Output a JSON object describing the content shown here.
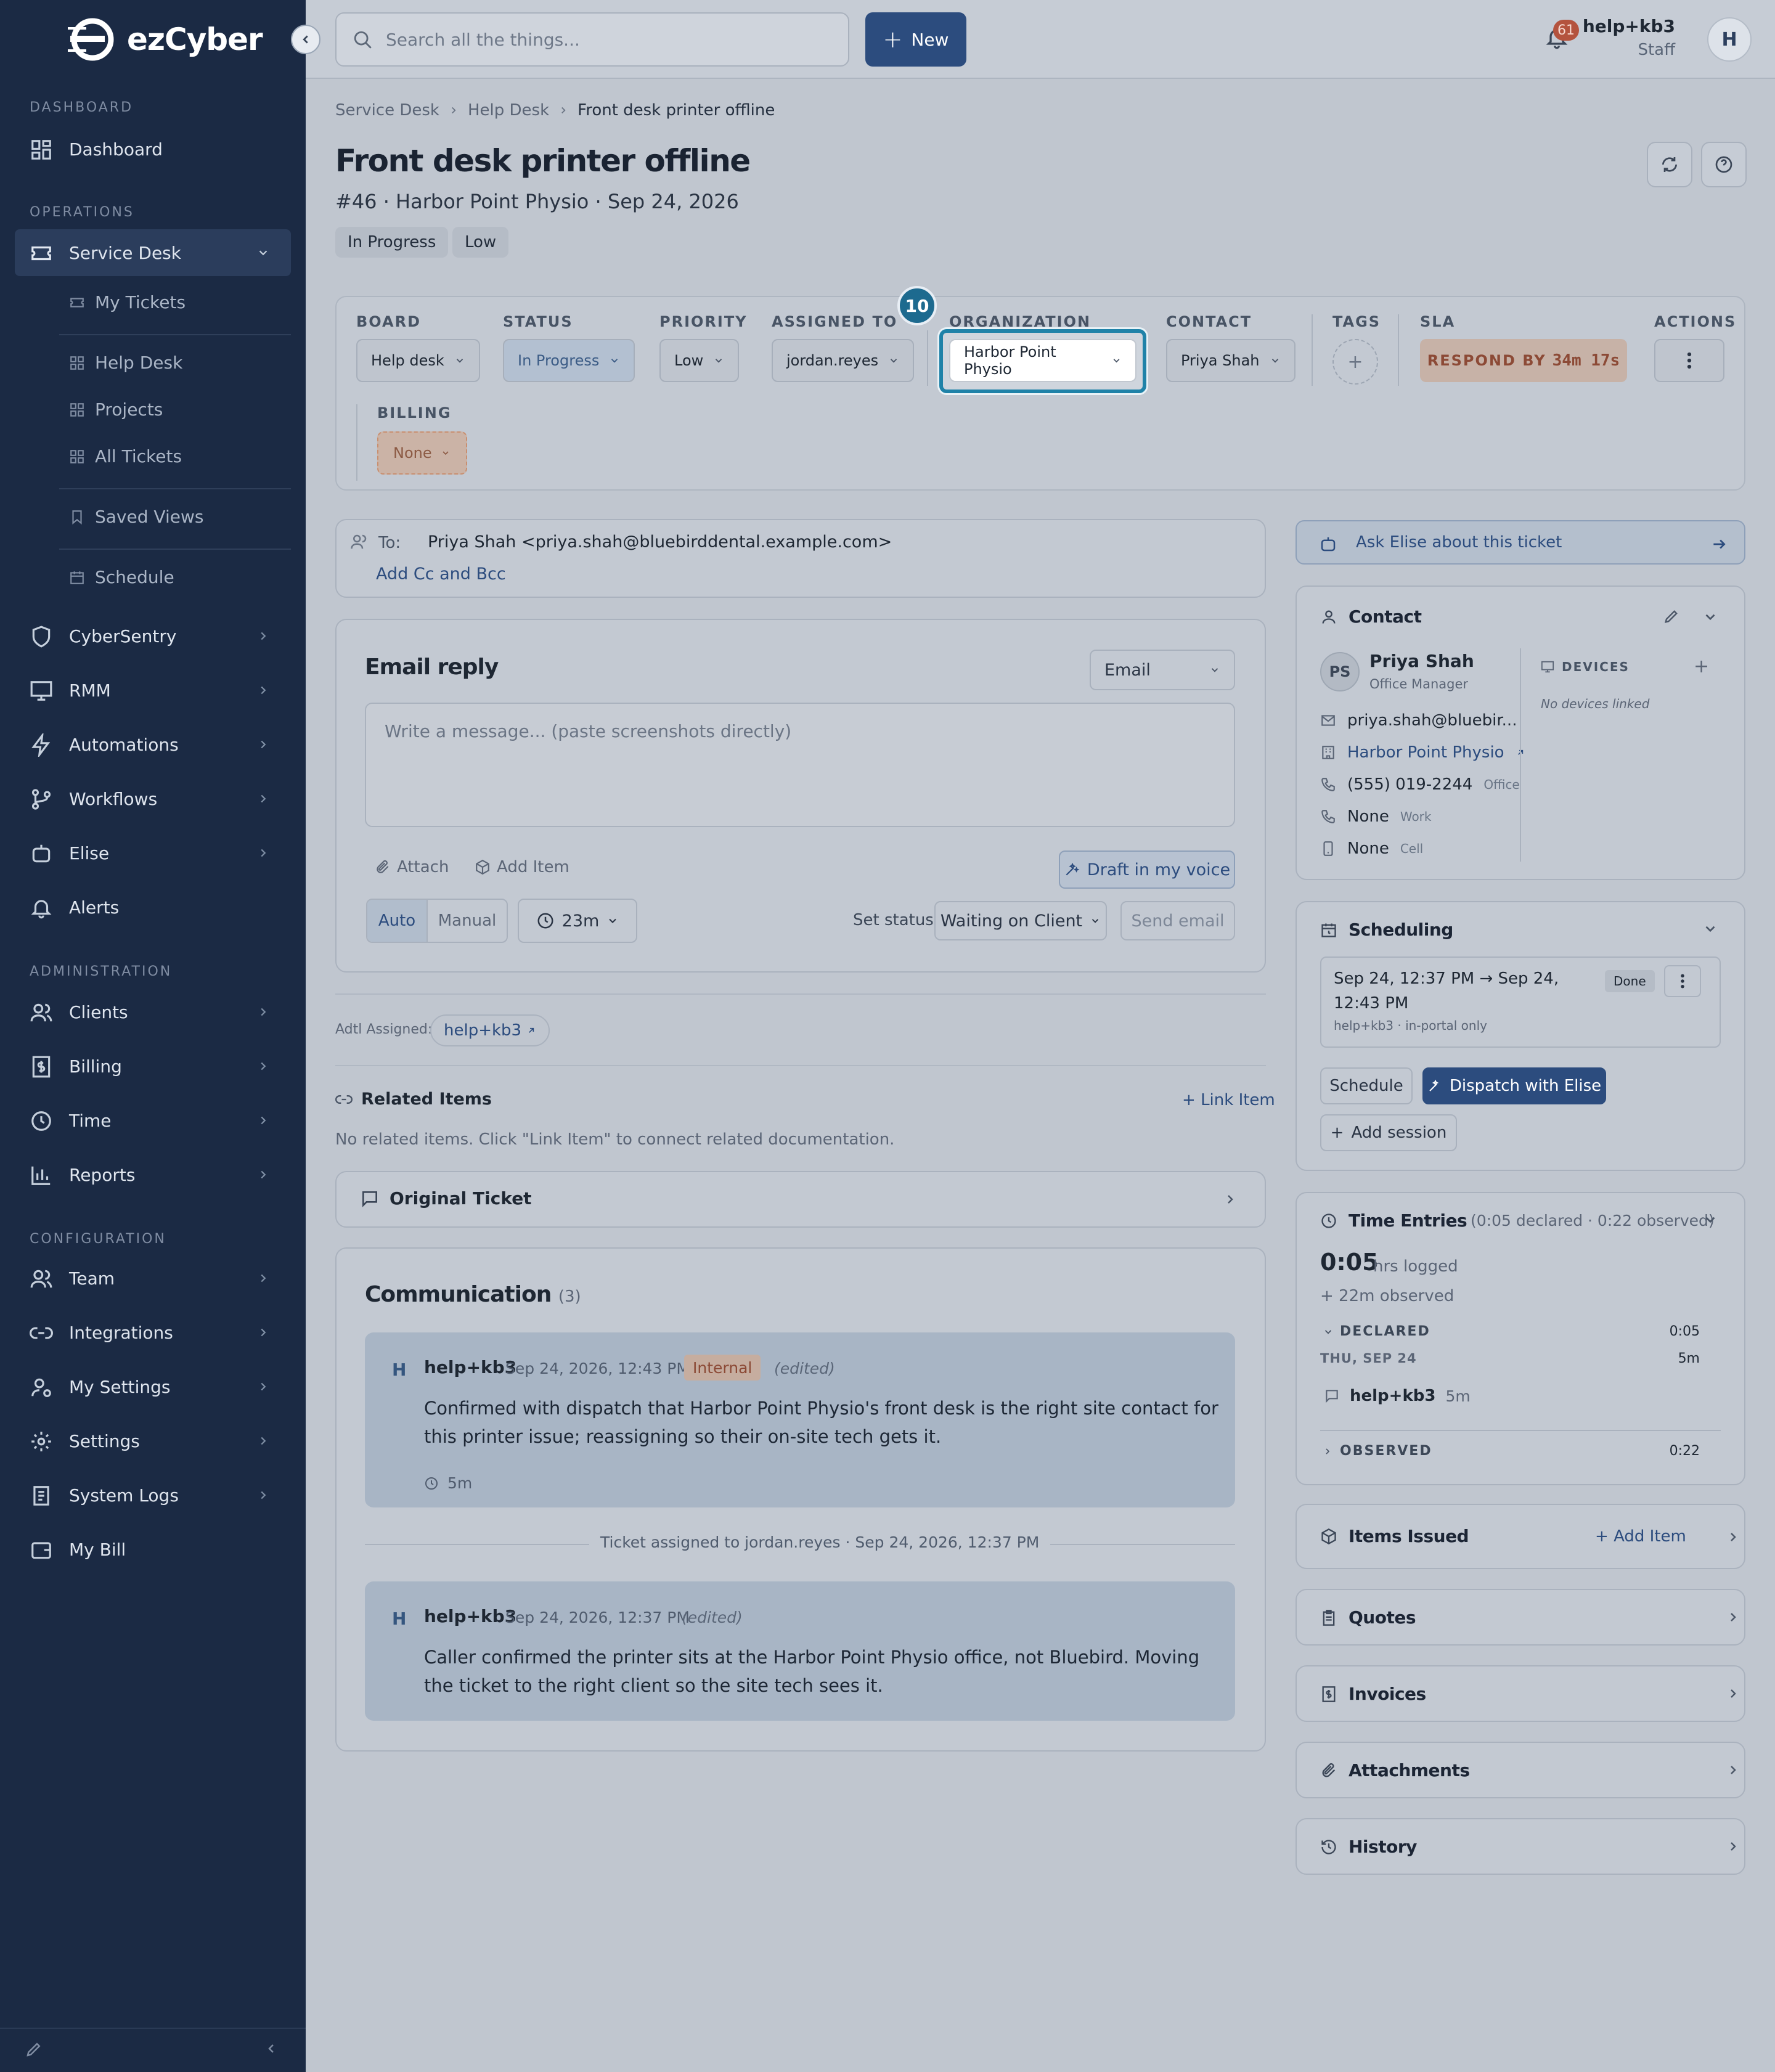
{
  "app": {
    "logo_text": "ezCyber"
  },
  "sidebar": {
    "sections": {
      "dashboard": "DASHBOARD",
      "operations": "OPERATIONS",
      "administration": "ADMINISTRATION",
      "configuration": "CONFIGURATION"
    },
    "dashboard": "Dashboard",
    "service_desk": "Service Desk",
    "sub": {
      "my_tickets": "My Tickets",
      "help_desk": "Help Desk",
      "projects": "Projects",
      "all_tickets": "All Tickets",
      "saved_views": "Saved Views",
      "schedule": "Schedule"
    },
    "ops": [
      "CyberSentry",
      "RMM",
      "Automations",
      "Workflows",
      "Elise",
      "Alerts"
    ],
    "admin": [
      "Clients",
      "Billing",
      "Time",
      "Reports"
    ],
    "config": [
      "Team",
      "Integrations",
      "My Settings",
      "Settings",
      "System Logs",
      "My Bill"
    ]
  },
  "topbar": {
    "search_placeholder": "Search all the things...",
    "new_label": "New",
    "notif_count": "61",
    "user_name": "help+kb3",
    "user_role": "Staff",
    "avatar": "H"
  },
  "breadcrumb": [
    "Service Desk",
    "Help Desk",
    "Front desk printer offline"
  ],
  "ticket": {
    "title": "Front desk printer offline",
    "subtitle": "#46 · Harbor Point Physio · Sep 24, 2026",
    "chips": [
      "In Progress",
      "Low"
    ]
  },
  "fields": {
    "board": {
      "label": "BOARD",
      "value": "Help desk"
    },
    "status": {
      "label": "STATUS",
      "value": "In Progress"
    },
    "priority": {
      "label": "PRIORITY",
      "value": "Low"
    },
    "assigned": {
      "label": "ASSIGNED TO",
      "value": "jordan.reyes"
    },
    "organization": {
      "label": "ORGANIZATION",
      "value": "Harbor Point Physio"
    },
    "contact": {
      "label": "CONTACT",
      "value": "Priya Shah"
    },
    "tags": {
      "label": "TAGS"
    },
    "sla": {
      "label": "SLA",
      "prefix": "RESPOND BY",
      "time": "34m 17s"
    },
    "actions": {
      "label": "ACTIONS"
    },
    "billing": {
      "label": "BILLING",
      "value": "None"
    },
    "step_number": "10"
  },
  "email": {
    "to_label": "To:",
    "to_value": "Priya Shah <priya.shah@bluebirddental.example.com>",
    "cc_link": "Add Cc and Bcc",
    "title": "Email reply",
    "channel": "Email",
    "placeholder": "Write a message... (paste screenshots directly)",
    "attach": "Attach",
    "add_item": "Add Item",
    "draft": "Draft in my voice",
    "auto": "Auto",
    "manual": "Manual",
    "timer": "23m",
    "set_status": "Set status",
    "status_value": "Waiting on Client",
    "send": "Send email"
  },
  "addl": {
    "label": "Adtl Assigned:",
    "user": "help+kb3"
  },
  "related": {
    "title": "Related Items",
    "link": "Link Item",
    "empty": "No related items. Click \"Link Item\" to connect related documentation."
  },
  "original": {
    "title": "Original Ticket"
  },
  "communication": {
    "title": "Communication",
    "count": "(3)",
    "entries": [
      {
        "avatar": "H",
        "name": "help+kb3",
        "time": "Sep 24, 2026, 12:43 PM",
        "tag": "Internal",
        "edited": "(edited)",
        "body": "Confirmed with dispatch that Harbor Point Physio's front desk is the right site contact for this printer issue; reassigning so their on-site tech gets it.",
        "duration": "5m"
      },
      {
        "avatar": "H",
        "name": "help+kb3",
        "time": "Sep 24, 2026, 12:37 PM",
        "edited": "(edited)",
        "body": "Caller confirmed the printer sits at the Harbor Point Physio office, not Bluebird. Moving the ticket to the right client so the site tech sees it."
      }
    ],
    "event": "Ticket assigned to jordan.reyes · Sep 24, 2026, 12:37 PM"
  },
  "right": {
    "ask": "Ask Elise about this ticket",
    "contact": {
      "title": "Contact",
      "initials": "PS",
      "name": "Priya Shah",
      "role": "Office Manager",
      "email": "priya.shah@bluebir...",
      "org": "Harbor Point Physio",
      "phone": "(555) 019-2244",
      "phone_type": "Office",
      "work": "None",
      "work_type": "Work",
      "cell": "None",
      "cell_type": "Cell",
      "devices": "DEVICES",
      "no_devices": "No devices linked"
    },
    "scheduling": {
      "title": "Scheduling",
      "range": "Sep 24, 12:37 PM → Sep 24, 12:43 PM",
      "state": "Done",
      "meta": "help+kb3 · in-portal only",
      "schedule": "Schedule",
      "dispatch": "Dispatch with Elise",
      "add_session": "Add session"
    },
    "time": {
      "title": "Time Entries",
      "summary": "(0:05 declared · 0:22 observed)",
      "hours": "0:05",
      "hours_label": "hrs logged",
      "observed_extra": "+ 22m observed",
      "declared": "DECLARED",
      "declared_val": "0:05",
      "day": "THU, SEP 24",
      "day_val": "5m",
      "entry_user": "help+kb3",
      "entry_val": "5m",
      "observed": "OBSERVED",
      "observed_val": "0:22"
    },
    "items": {
      "title": "Items Issued",
      "add": "Add Item"
    },
    "quotes": "Quotes",
    "invoices": "Invoices",
    "attachments": "Attachments",
    "history": "History"
  }
}
